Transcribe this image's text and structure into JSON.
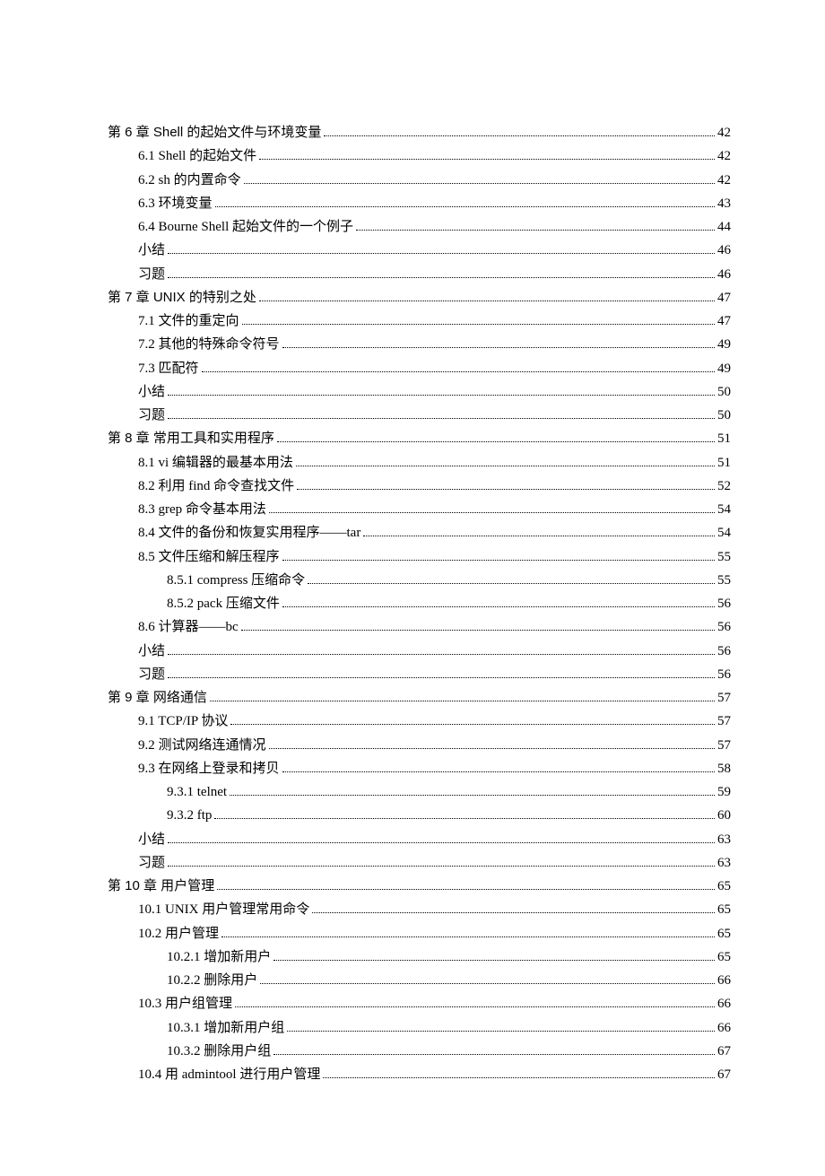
{
  "toc": [
    {
      "level": 0,
      "chapter": true,
      "label": "第 6 章  Shell 的起始文件与环境变量",
      "page": "42"
    },
    {
      "level": 1,
      "label": "6.1 Shell 的起始文件",
      "page": "42"
    },
    {
      "level": 1,
      "label": "6.2 sh 的内置命令",
      "page": "42"
    },
    {
      "level": 1,
      "label": "6.3  环境变量",
      "page": "43"
    },
    {
      "level": 1,
      "label": "6.4 Bourne Shell 起始文件的一个例子",
      "page": "44"
    },
    {
      "level": 1,
      "label": "小结",
      "page": "46"
    },
    {
      "level": 1,
      "label": "习题",
      "page": "46"
    },
    {
      "level": 0,
      "chapter": true,
      "label": "第 7 章  UNIX 的特别之处",
      "page": "47"
    },
    {
      "level": 1,
      "label": "7.1  文件的重定向",
      "page": "47"
    },
    {
      "level": 1,
      "label": "7.2  其他的特殊命令符号",
      "page": "49"
    },
    {
      "level": 1,
      "label": "7.3  匹配符",
      "page": "49"
    },
    {
      "level": 1,
      "label": "小结",
      "page": "50"
    },
    {
      "level": 1,
      "label": "习题",
      "page": "50"
    },
    {
      "level": 0,
      "chapter": true,
      "label": "第 8 章  常用工具和实用程序",
      "page": "51"
    },
    {
      "level": 1,
      "label": "8.1 vi 编辑器的最基本用法",
      "page": "51"
    },
    {
      "level": 1,
      "label": "8.2  利用 find 命令查找文件",
      "page": "52"
    },
    {
      "level": 1,
      "label": "8.3 grep 命令基本用法",
      "page": "54"
    },
    {
      "level": 1,
      "label": "8.4  文件的备份和恢复实用程序——tar",
      "page": "54"
    },
    {
      "level": 1,
      "label": "8.5  文件压缩和解压程序",
      "page": "55"
    },
    {
      "level": 2,
      "label": "8.5.1 compress 压缩命令",
      "page": "55"
    },
    {
      "level": 2,
      "label": "8.5.2 pack 压缩文件",
      "page": "56"
    },
    {
      "level": 1,
      "label": "8.6  计算器——bc",
      "page": "56"
    },
    {
      "level": 1,
      "label": "小结",
      "page": "56"
    },
    {
      "level": 1,
      "label": "习题",
      "page": "56"
    },
    {
      "level": 0,
      "chapter": true,
      "label": "第 9 章  网络通信",
      "page": "57"
    },
    {
      "level": 1,
      "label": "9.1 TCP/IP 协议",
      "page": "57"
    },
    {
      "level": 1,
      "label": "9.2  测试网络连通情况",
      "page": "57"
    },
    {
      "level": 1,
      "label": "9.3  在网络上登录和拷贝",
      "page": "58"
    },
    {
      "level": 2,
      "label": "9.3.1 telnet",
      "page": "59"
    },
    {
      "level": 2,
      "label": "9.3.2 ftp",
      "page": "60"
    },
    {
      "level": 1,
      "label": "小结",
      "page": "63"
    },
    {
      "level": 1,
      "label": "习题",
      "page": "63"
    },
    {
      "level": 0,
      "chapter": true,
      "label": "第 10 章  用户管理",
      "page": "65"
    },
    {
      "level": 1,
      "label": "10.1 UNIX 用户管理常用命令",
      "page": "65"
    },
    {
      "level": 1,
      "label": "10.2  用户管理",
      "page": "65"
    },
    {
      "level": 2,
      "label": "10.2.1  增加新用户",
      "page": "65"
    },
    {
      "level": 2,
      "label": "10.2.2  删除用户",
      "page": "66"
    },
    {
      "level": 1,
      "label": "10.3  用户组管理",
      "page": "66"
    },
    {
      "level": 2,
      "label": "10.3.1  增加新用户组",
      "page": "66"
    },
    {
      "level": 2,
      "label": "10.3.2  删除用户组",
      "page": "67"
    },
    {
      "level": 1,
      "label": "10.4  用 admintool 进行用户管理",
      "page": "67"
    }
  ]
}
